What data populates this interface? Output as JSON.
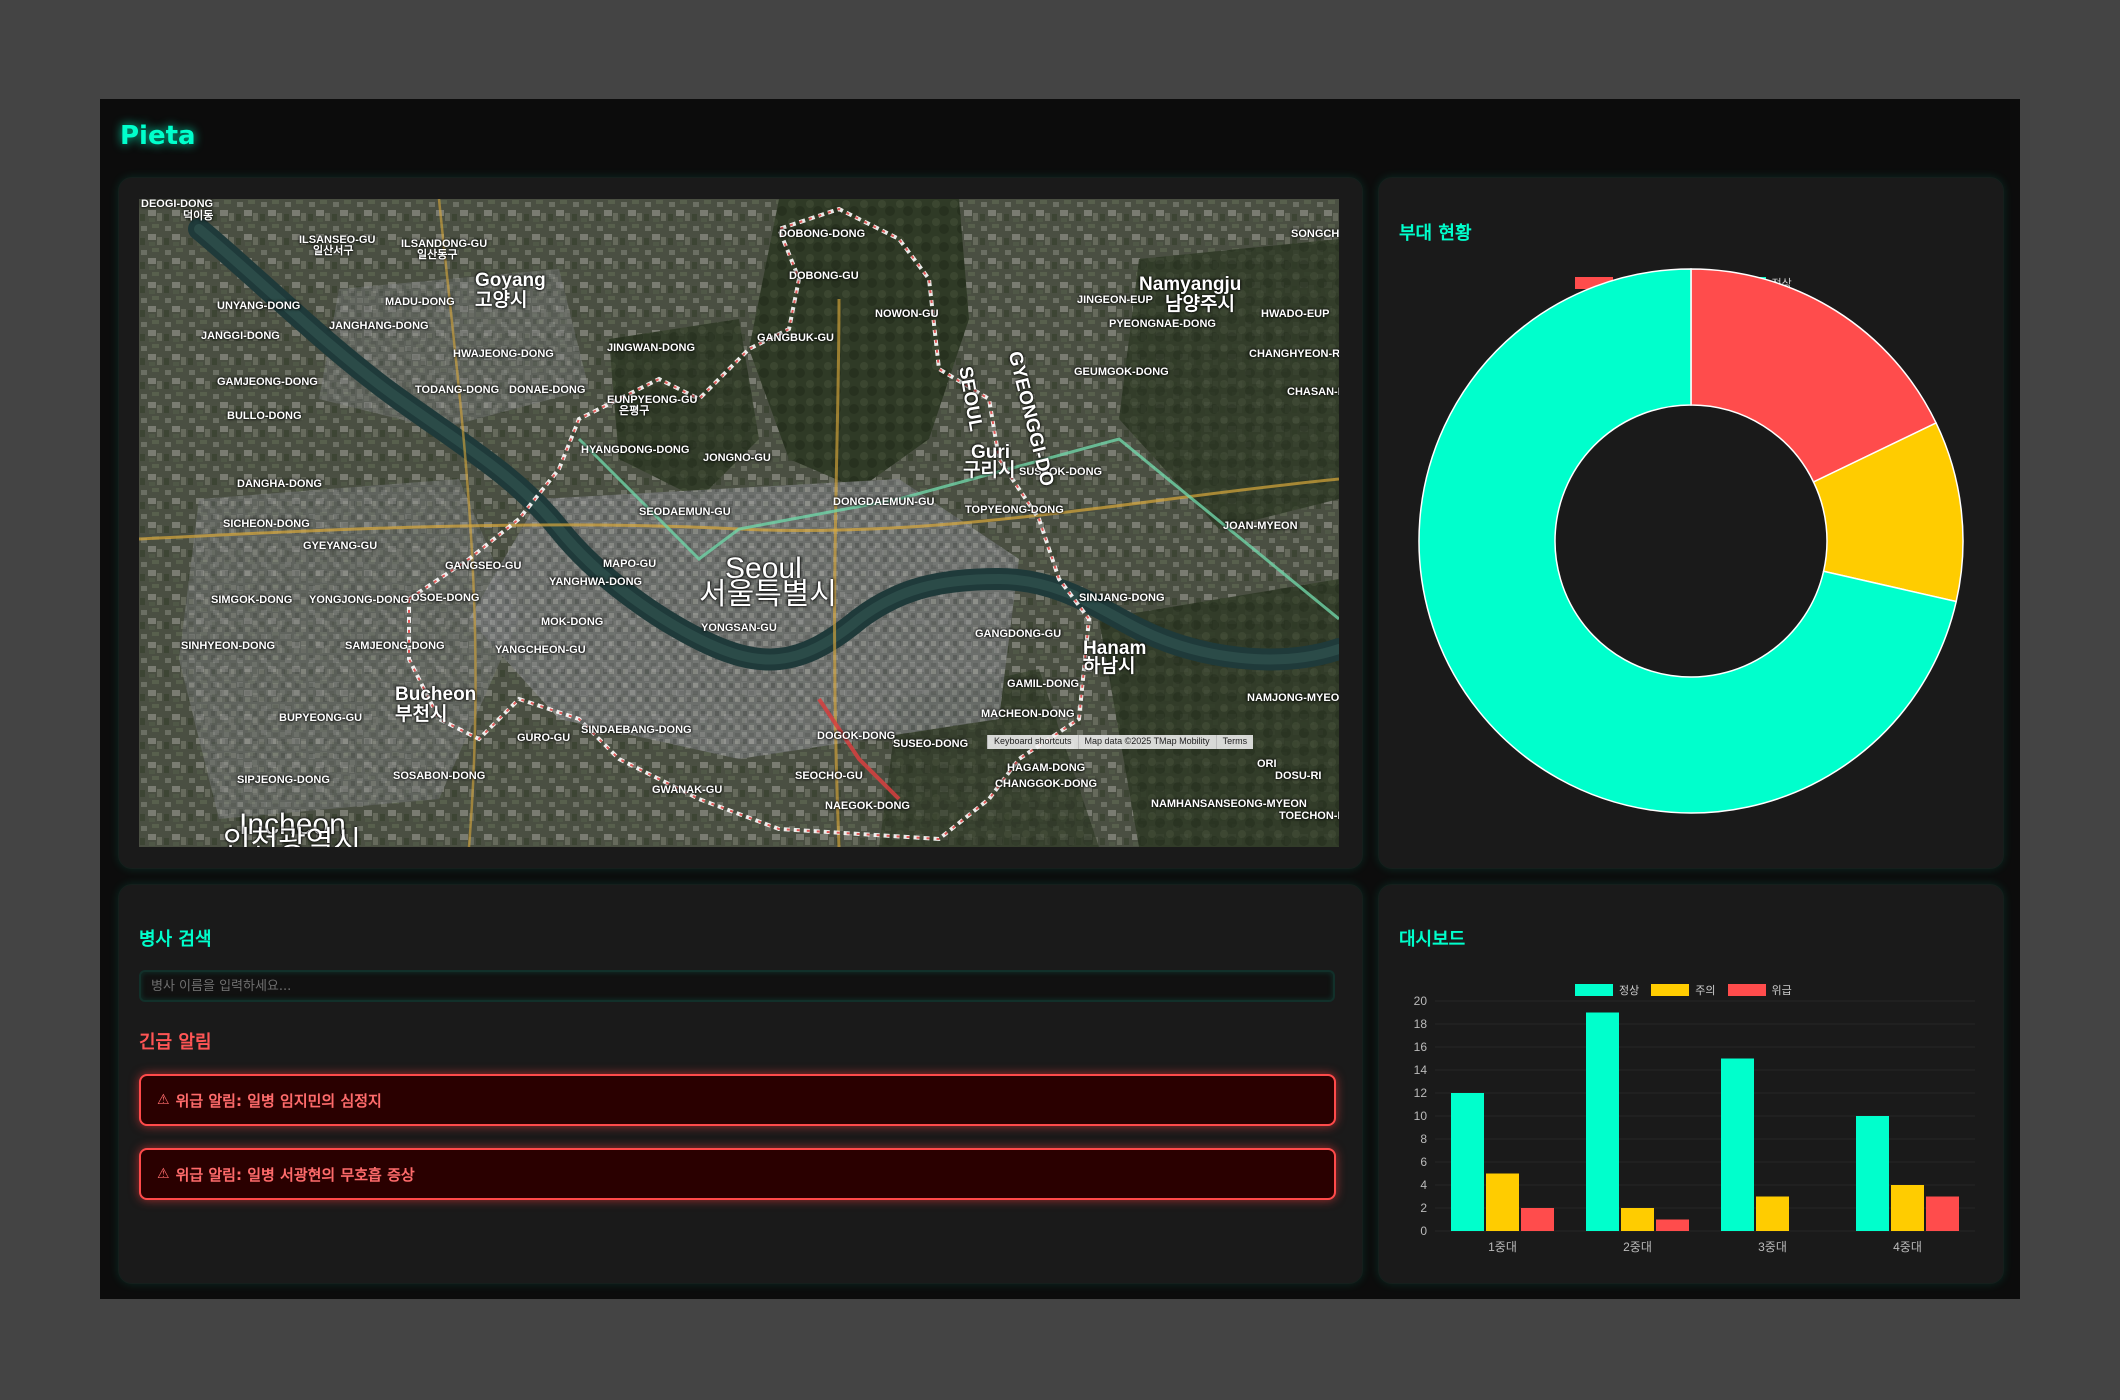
{
  "app": {
    "brand": "Pieta"
  },
  "colors": {
    "accent": "#00ffcc",
    "normal": "#00ffcc",
    "caution": "#ffcc00",
    "danger": "#ff4c4c",
    "panel": "#1a1a1a"
  },
  "map": {
    "attribution": [
      "Keyboard shortcuts",
      "Map data ©2025 TMap Mobility",
      "Terms"
    ],
    "labels": [
      {
        "t": "DEOGI-DONG",
        "s": "sm"
      },
      {
        "t": "덕이동",
        "s": "sm"
      },
      {
        "t": "ILSANSEO-GU",
        "s": "sm"
      },
      {
        "t": "일산서구",
        "s": "sm"
      },
      {
        "t": "ILSANDONG-GU",
        "s": "sm"
      },
      {
        "t": "일산동구",
        "s": "sm"
      },
      {
        "t": "Goyang",
        "s": "md"
      },
      {
        "t": "고양시",
        "s": "md"
      },
      {
        "t": "MADU-DONG",
        "s": "sm"
      },
      {
        "t": "UNYANG-DONG",
        "s": "sm"
      },
      {
        "t": "JANGHANG-DONG",
        "s": "sm"
      },
      {
        "t": "JANGGI-DONG",
        "s": "sm"
      },
      {
        "t": "HWAJEONG-DONG",
        "s": "sm"
      },
      {
        "t": "GAMJEONG-DONG",
        "s": "sm"
      },
      {
        "t": "TODANG-DONG",
        "s": "sm"
      },
      {
        "t": "DONAE-DONG",
        "s": "sm"
      },
      {
        "t": "BULLO-DONG",
        "s": "sm"
      },
      {
        "t": "EUNPYEONG-GU",
        "s": "sm"
      },
      {
        "t": "은평구",
        "s": "sm"
      },
      {
        "t": "JINGWAN-DONG",
        "s": "sm"
      },
      {
        "t": "GANGBUK-GU",
        "s": "sm"
      },
      {
        "t": "DOBONG-DONG",
        "s": "sm"
      },
      {
        "t": "DOBONG-GU",
        "s": "sm"
      },
      {
        "t": "NOWON-GU",
        "s": "sm"
      },
      {
        "t": "Namyangju",
        "s": "md"
      },
      {
        "t": "남양주시",
        "s": "md"
      },
      {
        "t": "JINGEON-EUP",
        "s": "sm"
      },
      {
        "t": "PYEONGNAE-DONG",
        "s": "sm"
      },
      {
        "t": "HWADO-EUP",
        "s": "sm"
      },
      {
        "t": "SONGCHEON-RI",
        "s": "sm"
      },
      {
        "t": "GEUMGOK-DONG",
        "s": "sm"
      },
      {
        "t": "CHANGHYEON-RI",
        "s": "sm"
      },
      {
        "t": "CHASAN-RI",
        "s": "sm"
      },
      {
        "t": "Guri",
        "s": "md"
      },
      {
        "t": "구리시",
        "s": "md"
      },
      {
        "t": "SUSEOK-DONG",
        "s": "sm"
      },
      {
        "t": "HYANGDONG-DONG",
        "s": "sm"
      },
      {
        "t": "JONGNO-GU",
        "s": "sm"
      },
      {
        "t": "DONGDAEMUN-GU",
        "s": "sm"
      },
      {
        "t": "TOPYEONG-DONG",
        "s": "sm"
      },
      {
        "t": "DANGHA-DONG",
        "s": "sm"
      },
      {
        "t": "SEODAEMUN-GU",
        "s": "sm"
      },
      {
        "t": "SICHEON-DONG",
        "s": "sm"
      },
      {
        "t": "GYEYANG-GU",
        "s": "sm"
      },
      {
        "t": "GANGSEO-GU",
        "s": "sm"
      },
      {
        "t": "MAPO-GU",
        "s": "sm"
      },
      {
        "t": "Seoul",
        "s": "lg"
      },
      {
        "t": "서울특별시",
        "s": "lg"
      },
      {
        "t": "JOAN-MYEON",
        "s": "sm"
      },
      {
        "t": "SIMGOK-DONG",
        "s": "sm"
      },
      {
        "t": "YONGJONG-DONG",
        "s": "sm"
      },
      {
        "t": "OSOE-DONG",
        "s": "sm"
      },
      {
        "t": "YANGHWA-DONG",
        "s": "sm"
      },
      {
        "t": "YONGSAN-GU",
        "s": "sm"
      },
      {
        "t": "GANGDONG-GU",
        "s": "sm"
      },
      {
        "t": "SINJANG-DONG",
        "s": "sm"
      },
      {
        "t": "MOK-DONG",
        "s": "sm"
      },
      {
        "t": "SINHYEON-DONG",
        "s": "sm"
      },
      {
        "t": "SAMJEONG-DONG",
        "s": "sm"
      },
      {
        "t": "YANGCHEON-GU",
        "s": "sm"
      },
      {
        "t": "Hanam",
        "s": "md"
      },
      {
        "t": "하남시",
        "s": "md"
      },
      {
        "t": "Bucheon",
        "s": "md"
      },
      {
        "t": "부천시",
        "s": "md"
      },
      {
        "t": "GAMIL-DONG",
        "s": "sm"
      },
      {
        "t": "BUPYEONG-GU",
        "s": "sm"
      },
      {
        "t": "MACHEON-DONG",
        "s": "sm"
      },
      {
        "t": "NAMJONG-MYEON",
        "s": "sm"
      },
      {
        "t": "GURO-GU",
        "s": "sm"
      },
      {
        "t": "SINDAEBANG-DONG",
        "s": "sm"
      },
      {
        "t": "DOGOK-DONG",
        "s": "sm"
      },
      {
        "t": "SUSEO-DONG",
        "s": "sm"
      },
      {
        "t": "SIPJEONG-DONG",
        "s": "sm"
      },
      {
        "t": "HAGAM-DONG",
        "s": "sm"
      },
      {
        "t": "ORI",
        "s": "sm"
      },
      {
        "t": "DOSU-RI",
        "s": "sm"
      },
      {
        "t": "SOSABON-DONG",
        "s": "sm"
      },
      {
        "t": "SEOCHO-GU",
        "s": "sm"
      },
      {
        "t": "CHANGGOK-DONG",
        "s": "sm"
      },
      {
        "t": "Incheon",
        "s": "lg"
      },
      {
        "t": "GWANAK-GU",
        "s": "sm"
      },
      {
        "t": "NAEGOK-DONG",
        "s": "sm"
      },
      {
        "t": "NAMHANSANSEONG-MYEON",
        "s": "sm"
      },
      {
        "t": "TOECHON-MYEON",
        "s": "sm"
      },
      {
        "t": "인천광역시",
        "s": "lg"
      },
      {
        "t": "SEOUL",
        "s": "md"
      },
      {
        "t": "GYEONGGI-DO",
        "s": "md"
      }
    ]
  },
  "status": {
    "title": "부대 현황",
    "legend": [
      "위급",
      "주의",
      "정상"
    ],
    "chart_data": {
      "type": "pie",
      "labels": [
        "위급",
        "주의",
        "정상"
      ],
      "values": [
        5,
        3,
        20
      ],
      "colors": [
        "#ff4c4c",
        "#ffcc00",
        "#00ffcc"
      ],
      "legend_position": "top"
    }
  },
  "dashboard": {
    "title": "대시보드",
    "chart_data": {
      "type": "bar",
      "categories": [
        "1중대",
        "2중대",
        "3중대",
        "4중대"
      ],
      "series": [
        {
          "name": "정상",
          "values": [
            12,
            19,
            15,
            10
          ],
          "color": "#00ffcc"
        },
        {
          "name": "주의",
          "values": [
            5,
            2,
            3,
            4
          ],
          "color": "#ffcc00"
        },
        {
          "name": "위급",
          "values": [
            2,
            1,
            0,
            3
          ],
          "color": "#ff4c4c"
        }
      ],
      "yticks": [
        "0",
        "2",
        "4",
        "6",
        "8",
        "10",
        "12",
        "14",
        "16",
        "18",
        "20"
      ],
      "ylim": [
        0,
        20
      ],
      "legend_position": "top"
    }
  },
  "search": {
    "title": "병사 검색",
    "placeholder": "병사 이름을 입력하세요...",
    "alerts_title": "긴급 알림",
    "alerts": [
      {
        "icon": "warning-icon",
        "text": "위급 알림: 일병 임지민의 심정지"
      },
      {
        "icon": "warning-icon",
        "text": "위급 알림: 일병 서광현의 무호흡 증상"
      }
    ]
  }
}
